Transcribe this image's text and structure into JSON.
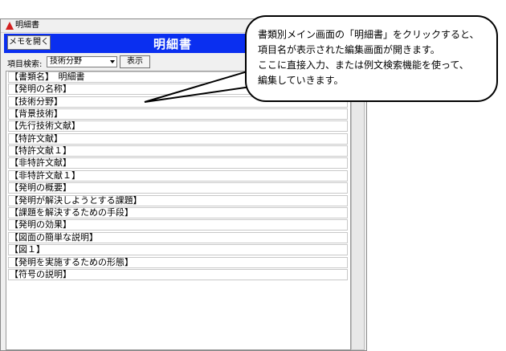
{
  "window": {
    "title": "明細書",
    "memo_button": "メモを開く",
    "header_title": "明細書"
  },
  "search": {
    "label": "項目検索:",
    "selected": "技術分野",
    "show_button": "表示"
  },
  "document_lines": [
    "【書類名】　明細書",
    "【発明の名称】",
    "【技術分野】",
    "【背景技術】",
    "【先行技術文献】",
    "【特許文献】",
    "【特許文献１】",
    "【非特許文献】",
    "【非特許文献１】",
    "【発明の概要】",
    "【発明が解決しようとする課題】",
    "【課題を解決するための手段】",
    "【発明の効果】",
    "【図面の簡単な説明】",
    "【図１】",
    "【発明を実施するための形態】",
    "【符号の説明】"
  ],
  "callout": {
    "lines": [
      "書類別メイン画面の「明細書」をクリックすると、",
      "項目名が表示された編集画面が開きます。",
      "ここに直接入力、または例文検索機能を使って、",
      "編集していきます。"
    ]
  },
  "colors": {
    "header_bg": "#0a2ff0",
    "app_icon": "#d42020"
  }
}
